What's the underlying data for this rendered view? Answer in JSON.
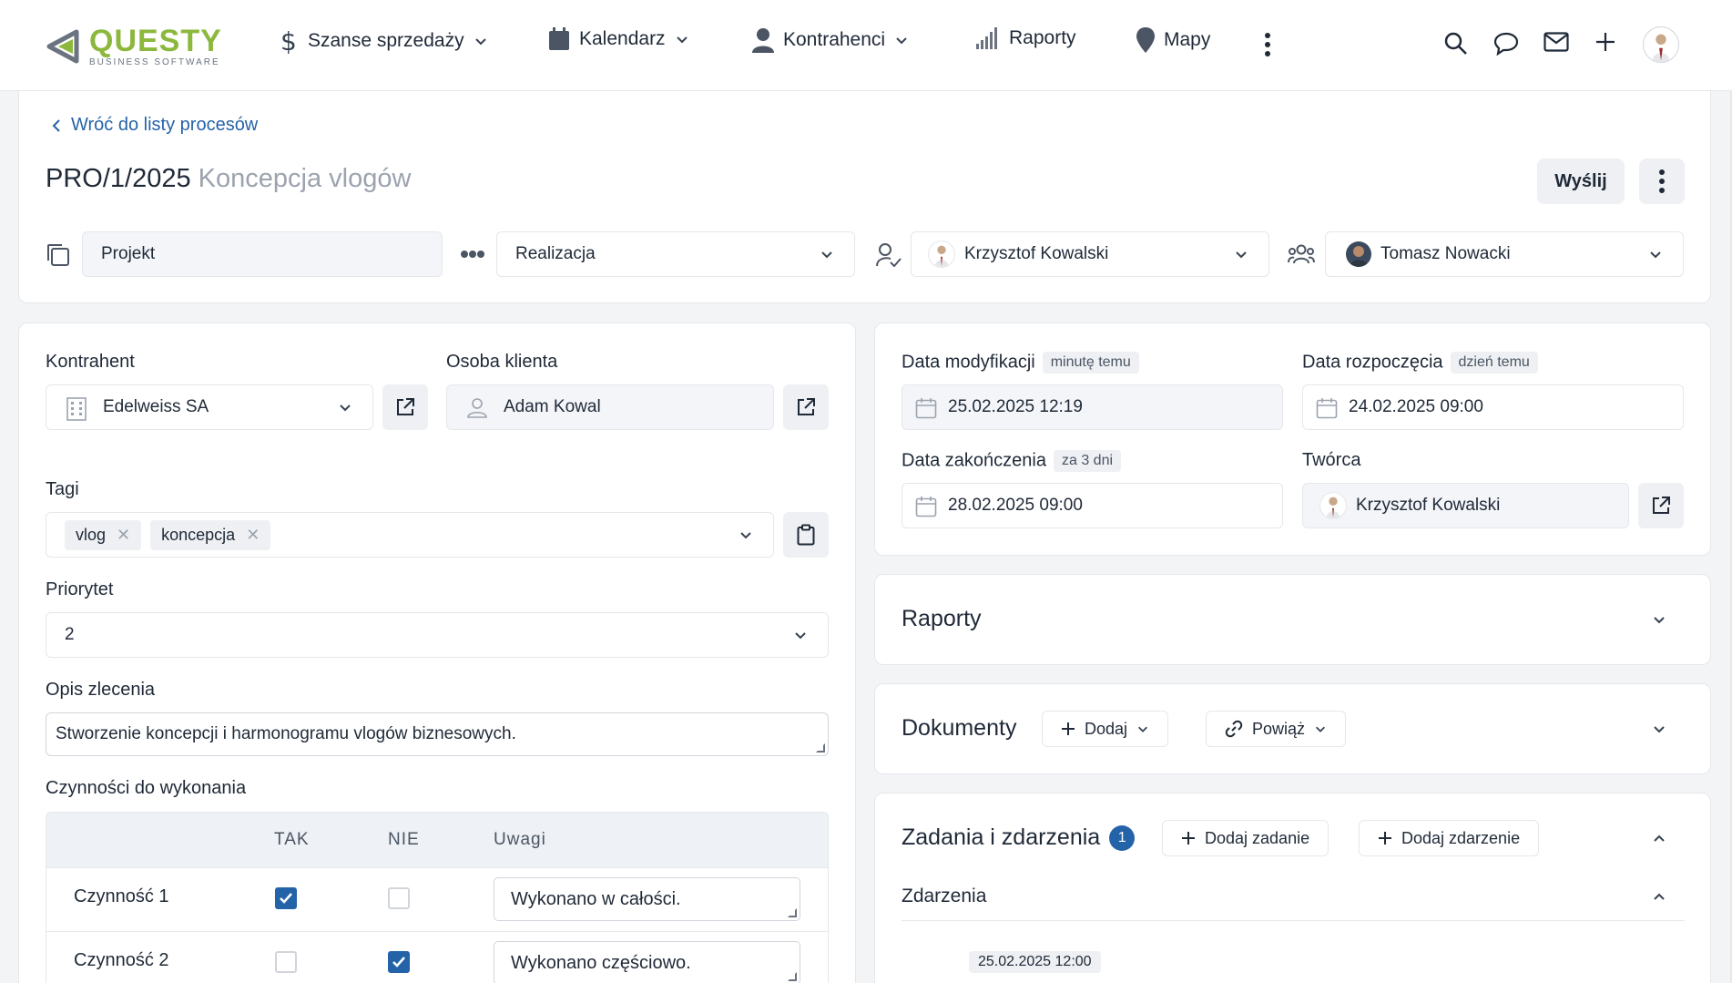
{
  "brand": {
    "name": "QUESTY",
    "tagline": "BUSINESS SOFTWARE"
  },
  "nav": [
    {
      "label": "Szanse sprzedaży",
      "icon": "dollar-icon"
    },
    {
      "label": "Kalendarz",
      "icon": "calendar-icon"
    },
    {
      "label": "Kontrahenci",
      "icon": "person-icon"
    },
    {
      "label": "Raporty",
      "icon": "bar-signal-icon"
    },
    {
      "label": "Mapy",
      "icon": "map-pin-icon"
    }
  ],
  "back_link": "Wróć do listy procesów",
  "header": {
    "code": "PRO/1/2025",
    "name": "Koncepcja vlogów",
    "send_label": "Wyślij"
  },
  "process": {
    "type": "Projekt",
    "stage": "Realizacja",
    "owner": "Krzysztof Kowalski",
    "participant": "Tomasz Nowacki"
  },
  "left": {
    "contractor_label": "Kontrahent",
    "contractor": "Edelweiss SA",
    "client_person_label": "Osoba klienta",
    "client_person": "Adam Kowal",
    "tags_label": "Tagi",
    "tags": [
      "vlog",
      "koncepcja"
    ],
    "priority_label": "Priorytet",
    "priority": "2",
    "description_label": "Opis zlecenia",
    "description": "Stworzenie koncepcji i harmonogramu vlogów biznesowych.",
    "activities_label": "Czynności do wykonania",
    "activities_columns": [
      "TAK",
      "NIE",
      "Uwagi"
    ],
    "activities": [
      {
        "name": "Czynność 1",
        "yes": true,
        "no": false,
        "note": "Wykonano w całości."
      },
      {
        "name": "Czynność 2",
        "yes": false,
        "no": true,
        "note": "Wykonano częściowo."
      }
    ]
  },
  "right": {
    "modified_label": "Data modyfikacji",
    "modified_badge": "minutę temu",
    "modified_value": "25.02.2025 12:19",
    "start_label": "Data rozpoczęcia",
    "start_badge": "dzień temu",
    "start_value": "24.02.2025 09:00",
    "end_label": "Data zakończenia",
    "end_badge": "za 3 dni",
    "end_value": "28.02.2025 09:00",
    "creator_label": "Twórca",
    "creator": "Krzysztof Kowalski",
    "reports_title": "Raporty",
    "documents_title": "Dokumenty",
    "documents_add": "Dodaj",
    "documents_link": "Powiąż",
    "tasks_title": "Zadania i zdarzenia",
    "tasks_count": "1",
    "add_task": "Dodaj zadanie",
    "add_event": "Dodaj zdarzenie",
    "events_title": "Zdarzenia",
    "event_date": "25.02.2025 12:00"
  },
  "colors": {
    "accent": "#2563a8",
    "brand_green": "#8cb83e"
  }
}
